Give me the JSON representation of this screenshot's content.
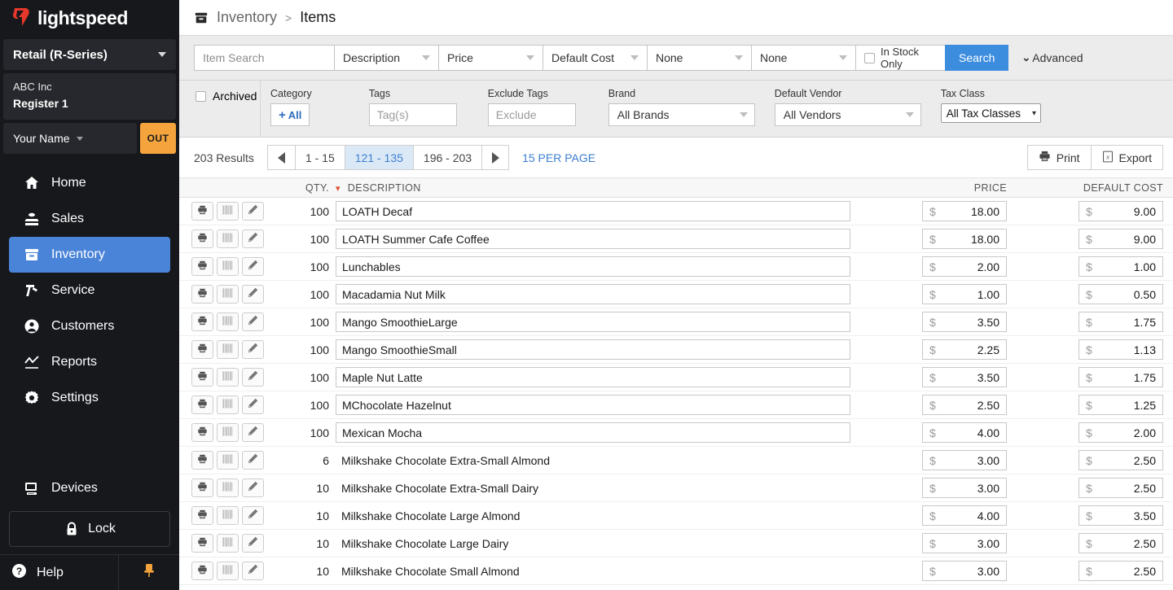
{
  "sidebar": {
    "brand": "lightspeed",
    "account_select": "Retail (R-Series)",
    "store_name": "ABC Inc",
    "register_name": "Register 1",
    "user_name": "Your Name",
    "out_label": "OUT",
    "nav_items": [
      {
        "label": "Home",
        "icon": "home-icon",
        "active": false
      },
      {
        "label": "Sales",
        "icon": "sales-icon",
        "active": false
      },
      {
        "label": "Inventory",
        "icon": "inventory-icon",
        "active": true
      },
      {
        "label": "Service",
        "icon": "service-icon",
        "active": false
      },
      {
        "label": "Customers",
        "icon": "customers-icon",
        "active": false
      },
      {
        "label": "Reports",
        "icon": "reports-icon",
        "active": false
      },
      {
        "label": "Settings",
        "icon": "settings-icon",
        "active": false
      }
    ],
    "devices_label": "Devices",
    "lock_label": "Lock",
    "help_label": "Help",
    "accent_active": "#4a84d8",
    "accent_out": "#f5a33c"
  },
  "breadcrumb": {
    "section": "Inventory",
    "separator": ">",
    "current": "Items"
  },
  "search_bar": {
    "item_search_placeholder": "Item Search",
    "field_1": "Description",
    "field_2": "Price",
    "field_3": "Default Cost",
    "field_4": "None",
    "field_5": "None",
    "in_stock_only_label": "In Stock Only",
    "search_label": "Search",
    "advanced_label": "Advanced",
    "advanced_caret": "⌄"
  },
  "advanced_filters": {
    "archived_label": "Archived",
    "category_label": "Category",
    "category_button": "All",
    "tags_label": "Tags",
    "tags_placeholder": "Tag(s)",
    "exclude_tags_label": "Exclude Tags",
    "exclude_tags_placeholder": "Exclude",
    "brand_label": "Brand",
    "brand_value": "All Brands",
    "vendor_label": "Default Vendor",
    "vendor_value": "All Vendors",
    "tax_class_label": "Tax Class",
    "tax_class_value": "All Tax Classes"
  },
  "pagination": {
    "results": "203 Results",
    "pages": [
      "1 - 15",
      "121 - 135",
      "196 - 203"
    ],
    "active_index": 1,
    "per_page": "15 PER PAGE",
    "print_label": "Print",
    "export_label": "Export"
  },
  "table": {
    "headers": {
      "qty": "QTY.",
      "description": "DESCRIPTION",
      "price": "PRICE",
      "default_cost": "DEFAULT COST"
    },
    "rows": [
      {
        "qty": "100",
        "description": "LOATH Decaf",
        "price": "18.00",
        "cost": "9.00",
        "editable": true
      },
      {
        "qty": "100",
        "description": "LOATH Summer Cafe Coffee",
        "price": "18.00",
        "cost": "9.00",
        "editable": true
      },
      {
        "qty": "100",
        "description": "Lunchables",
        "price": "2.00",
        "cost": "1.00",
        "editable": true
      },
      {
        "qty": "100",
        "description": "Macadamia Nut Milk",
        "price": "1.00",
        "cost": "0.50",
        "editable": true
      },
      {
        "qty": "100",
        "description": "Mango SmoothieLarge",
        "price": "3.50",
        "cost": "1.75",
        "editable": true
      },
      {
        "qty": "100",
        "description": "Mango SmoothieSmall",
        "price": "2.25",
        "cost": "1.13",
        "editable": true
      },
      {
        "qty": "100",
        "description": "Maple Nut Latte",
        "price": "3.50",
        "cost": "1.75",
        "editable": true
      },
      {
        "qty": "100",
        "description": "MChocolate Hazelnut",
        "price": "2.50",
        "cost": "1.25",
        "editable": true
      },
      {
        "qty": "100",
        "description": "Mexican Mocha",
        "price": "4.00",
        "cost": "2.00",
        "editable": true
      },
      {
        "qty": "6",
        "description": "Milkshake Chocolate Extra-Small Almond",
        "price": "3.00",
        "cost": "2.50",
        "editable": false
      },
      {
        "qty": "10",
        "description": "Milkshake Chocolate Extra-Small Dairy",
        "price": "3.00",
        "cost": "2.50",
        "editable": false
      },
      {
        "qty": "10",
        "description": "Milkshake Chocolate Large Almond",
        "price": "4.00",
        "cost": "3.50",
        "editable": false
      },
      {
        "qty": "10",
        "description": "Milkshake Chocolate Large Dairy",
        "price": "3.00",
        "cost": "2.50",
        "editable": false
      },
      {
        "qty": "10",
        "description": "Milkshake Chocolate Small Almond",
        "price": "3.00",
        "cost": "2.50",
        "editable": false
      }
    ],
    "currency_symbol": "$",
    "row_actions": [
      "print-label-icon",
      "barcode-icon",
      "edit-pencil-icon"
    ]
  }
}
